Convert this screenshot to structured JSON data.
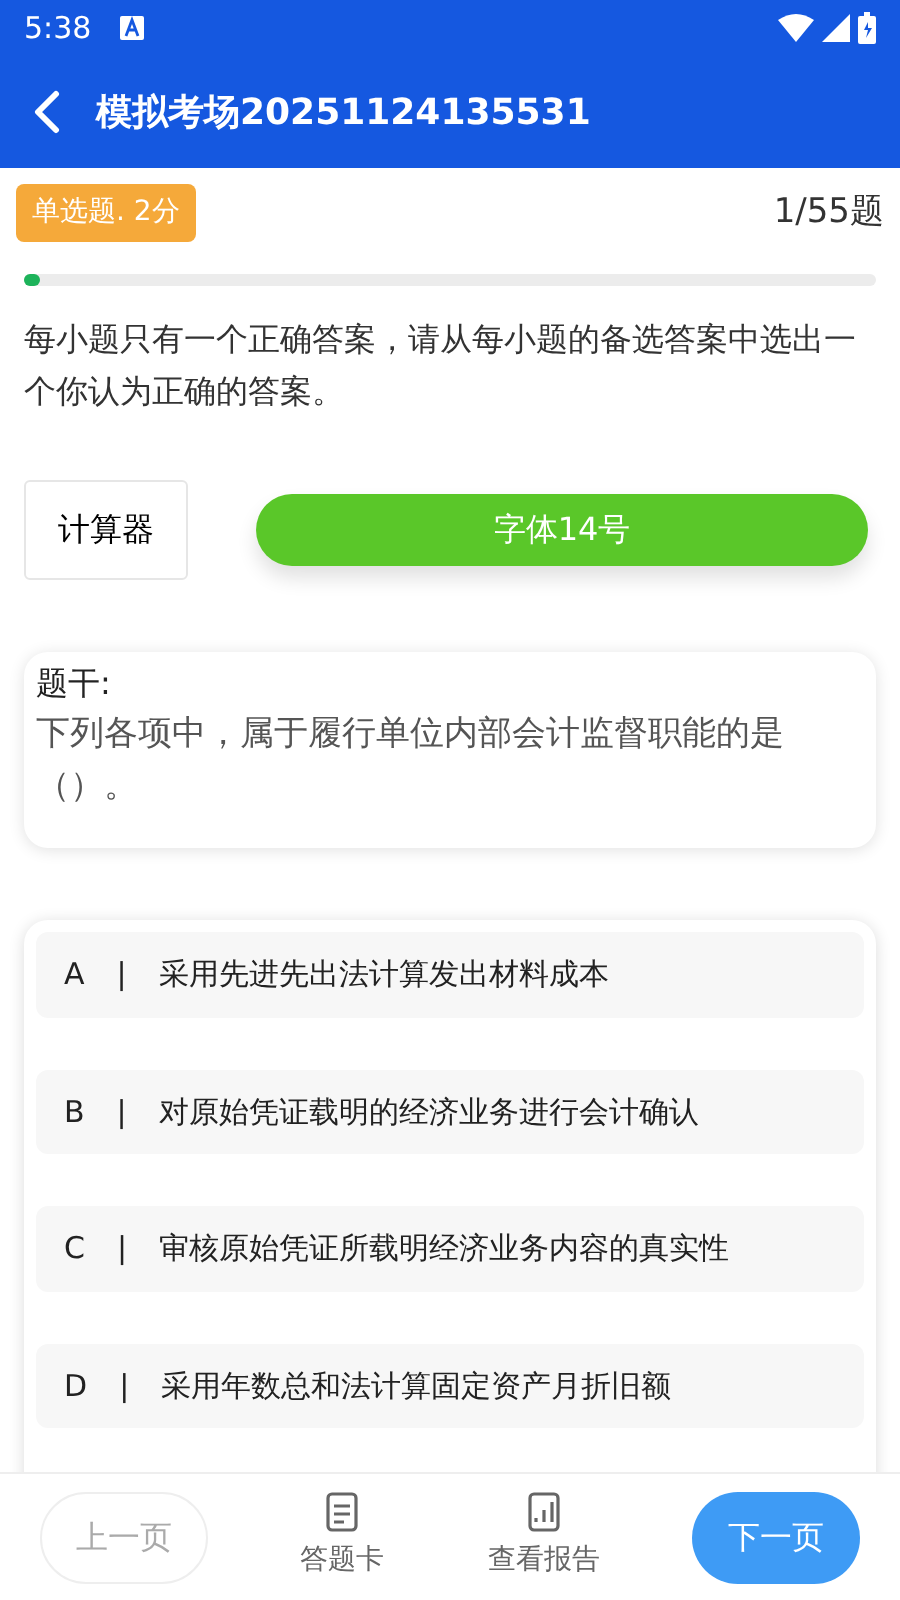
{
  "status_bar": {
    "time": "5:38"
  },
  "app_bar": {
    "title": "模拟考场20251124135531"
  },
  "question_meta": {
    "type_badge": "单选题. 2分",
    "counter": "1/55题",
    "progress": {
      "level": 0.018
    }
  },
  "instruction": "每小题只有一个正确答案，请从每小题的备选答案中选出一个你认为正确的答案。",
  "tools": [
    {
      "label": "计算器",
      "kind": "plain"
    },
    {
      "label": "字体14号",
      "kind": "pill"
    }
  ],
  "stem": {
    "label": "题干:",
    "text": "下列各项中，属于履行单位内部会计监督职能的是（）。"
  },
  "options": [
    {
      "letter": "A",
      "separator": "|",
      "text": "采用先进先出法计算发出材料成本",
      "selected": false
    },
    {
      "letter": "B",
      "separator": "|",
      "text": "对原始凭证载明的经济业务进行会计确认",
      "selected": false
    },
    {
      "letter": "C",
      "separator": "|",
      "text": "审核原始凭证所载明经济业务内容的真实性",
      "selected": false
    },
    {
      "letter": "D",
      "separator": "|",
      "text": "采用年数总和法计算固定资产月折旧额",
      "selected": false
    }
  ],
  "bottom_bar": [
    {
      "label": "上一页",
      "kind": "outline"
    },
    {
      "label": "答题卡",
      "kind": "icon"
    },
    {
      "label": "查看报告",
      "kind": "icon"
    },
    {
      "label": "下一页",
      "kind": "primary"
    }
  ]
}
